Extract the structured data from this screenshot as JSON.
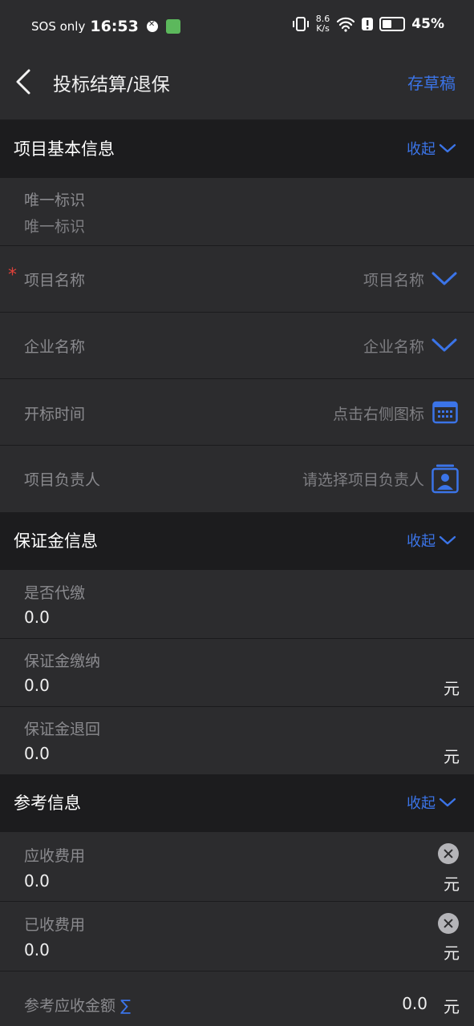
{
  "status_bar": {
    "carrier": "SOS only",
    "time": "16:53",
    "speed_value": "8.6",
    "speed_unit": "K/s",
    "battery": "45%"
  },
  "header": {
    "title": "投标结算/退保",
    "draft_label": "存草稿"
  },
  "colors": {
    "accent": "#3b74e8",
    "required": "#e0413a",
    "section_bg": "#1c1c1e",
    "row_bg": "#2c2c2e"
  },
  "basic_info": {
    "title": "项目基本信息",
    "collapse_label": "收起",
    "unique_id": {
      "label": "唯一标识",
      "placeholder": "唯一标识"
    },
    "project_name": {
      "label": "项目名称",
      "hint": "项目名称"
    },
    "company_name": {
      "label": "企业名称",
      "hint": "企业名称"
    },
    "bid_time": {
      "label": "开标时间",
      "hint": "点击右侧图标"
    },
    "project_leader": {
      "label": "项目负责人",
      "hint": "请选择项目负责人"
    }
  },
  "deposit_info": {
    "title": "保证金信息",
    "collapse_label": "收起",
    "is_proxy": {
      "label": "是否代缴",
      "value": "0.0"
    },
    "deposit_paid": {
      "label": "保证金缴纳",
      "value": "0.0",
      "unit": "元"
    },
    "deposit_returned": {
      "label": "保证金退回",
      "value": "0.0",
      "unit": "元"
    }
  },
  "reference_info": {
    "title": "参考信息",
    "collapse_label": "收起",
    "receivable_fee": {
      "label": "应收费用",
      "value": "0.0",
      "unit": "元"
    },
    "received_fee": {
      "label": "已收费用",
      "value": "0.0",
      "unit": "元"
    },
    "reference_amount": {
      "label": "参考应收金额",
      "symbol": "∑",
      "value": "0.0",
      "unit": "元"
    }
  }
}
